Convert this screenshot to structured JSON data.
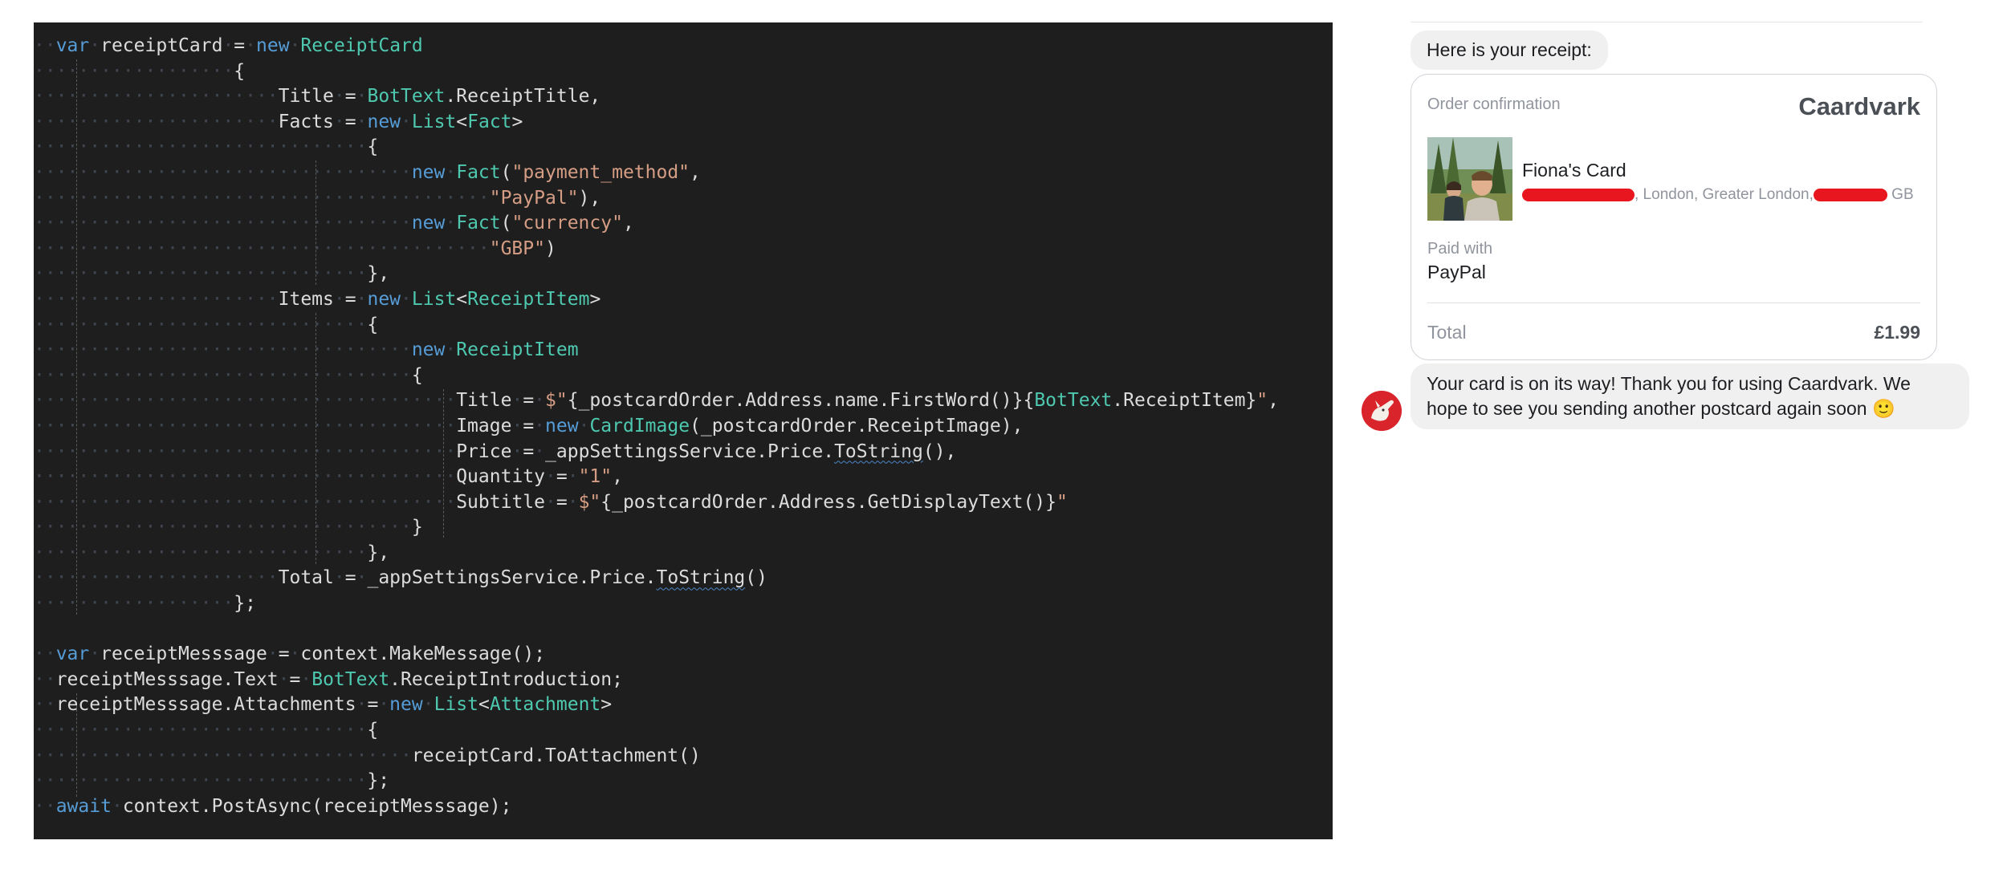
{
  "code": {
    "lines": [
      [
        [
          "ws",
          "··"
        ],
        [
          "kw",
          "var"
        ],
        [
          "ws",
          "·"
        ],
        [
          "pl",
          "receiptCard"
        ],
        [
          "ws",
          "·"
        ],
        [
          "pl",
          "="
        ],
        [
          "ws",
          "·"
        ],
        [
          "kw",
          "new"
        ],
        [
          "ws",
          "·"
        ],
        [
          "ty",
          "ReceiptCard"
        ]
      ],
      [
        [
          "ws",
          "··················"
        ],
        [
          "pl",
          "{"
        ]
      ],
      [
        [
          "ws",
          "······················"
        ],
        [
          "pl",
          "Title"
        ],
        [
          "ws",
          "·"
        ],
        [
          "pl",
          "="
        ],
        [
          "ws",
          "·"
        ],
        [
          "ty",
          "BotText"
        ],
        [
          "pl",
          ".ReceiptTitle,"
        ]
      ],
      [
        [
          "ws",
          "······················"
        ],
        [
          "pl",
          "Facts"
        ],
        [
          "ws",
          "·"
        ],
        [
          "pl",
          "="
        ],
        [
          "ws",
          "·"
        ],
        [
          "kw",
          "new"
        ],
        [
          "ws",
          "·"
        ],
        [
          "ty",
          "List"
        ],
        [
          "pl",
          "<"
        ],
        [
          "ty",
          "Fact"
        ],
        [
          "pl",
          ">"
        ]
      ],
      [
        [
          "ws",
          "······························"
        ],
        [
          "pl",
          "{"
        ]
      ],
      [
        [
          "ws",
          "··································"
        ],
        [
          "kw",
          "new"
        ],
        [
          "ws",
          "·"
        ],
        [
          "ty",
          "Fact"
        ],
        [
          "pl",
          "("
        ],
        [
          "str",
          "\"payment_method\""
        ],
        [
          "pl",
          ","
        ]
      ],
      [
        [
          "ws",
          "·········································"
        ],
        [
          "str",
          "\"PayPal\""
        ],
        [
          "pl",
          "),"
        ]
      ],
      [
        [
          "ws",
          "··································"
        ],
        [
          "kw",
          "new"
        ],
        [
          "ws",
          "·"
        ],
        [
          "ty",
          "Fact"
        ],
        [
          "pl",
          "("
        ],
        [
          "str",
          "\"currency\""
        ],
        [
          "pl",
          ","
        ]
      ],
      [
        [
          "ws",
          "·········································"
        ],
        [
          "str",
          "\"GBP\""
        ],
        [
          "pl",
          ")"
        ]
      ],
      [
        [
          "ws",
          "······························"
        ],
        [
          "pl",
          "},"
        ]
      ],
      [
        [
          "ws",
          "······················"
        ],
        [
          "pl",
          "Items"
        ],
        [
          "ws",
          "·"
        ],
        [
          "pl",
          "="
        ],
        [
          "ws",
          "·"
        ],
        [
          "kw",
          "new"
        ],
        [
          "ws",
          "·"
        ],
        [
          "ty",
          "List"
        ],
        [
          "pl",
          "<"
        ],
        [
          "ty",
          "ReceiptItem"
        ],
        [
          "pl",
          ">"
        ]
      ],
      [
        [
          "ws",
          "······························"
        ],
        [
          "pl",
          "{"
        ]
      ],
      [
        [
          "ws",
          "··································"
        ],
        [
          "kw",
          "new"
        ],
        [
          "ws",
          "·"
        ],
        [
          "ty",
          "ReceiptItem"
        ]
      ],
      [
        [
          "ws",
          "··································"
        ],
        [
          "pl",
          "{"
        ]
      ],
      [
        [
          "ws",
          "······································"
        ],
        [
          "pl",
          "Title"
        ],
        [
          "ws",
          "·"
        ],
        [
          "pl",
          "="
        ],
        [
          "ws",
          "·"
        ],
        [
          "str",
          "$\""
        ],
        [
          "pl",
          "{_postcardOrder.Address.name.FirstWord()}{"
        ],
        [
          "ty",
          "BotText"
        ],
        [
          "pl",
          ".ReceiptItem}"
        ],
        [
          "str",
          "\""
        ],
        [
          "pl",
          ","
        ]
      ],
      [
        [
          "ws",
          "······································"
        ],
        [
          "pl",
          "Image"
        ],
        [
          "ws",
          "·"
        ],
        [
          "pl",
          "="
        ],
        [
          "ws",
          "·"
        ],
        [
          "kw",
          "new"
        ],
        [
          "ws",
          "·"
        ],
        [
          "ty",
          "CardImage"
        ],
        [
          "pl",
          "(_postcardOrder.ReceiptImage),"
        ]
      ],
      [
        [
          "ws",
          "······································"
        ],
        [
          "pl",
          "Price"
        ],
        [
          "ws",
          "·"
        ],
        [
          "pl",
          "="
        ],
        [
          "ws",
          "·"
        ],
        [
          "pl",
          "_appSettingsService.Price."
        ],
        [
          "sq",
          "ToString"
        ],
        [
          "pl",
          "(),"
        ]
      ],
      [
        [
          "ws",
          "······································"
        ],
        [
          "pl",
          "Quantity"
        ],
        [
          "ws",
          "·"
        ],
        [
          "pl",
          "="
        ],
        [
          "ws",
          "·"
        ],
        [
          "str",
          "\"1\""
        ],
        [
          "pl",
          ","
        ]
      ],
      [
        [
          "ws",
          "······································"
        ],
        [
          "pl",
          "Subtitle"
        ],
        [
          "ws",
          "·"
        ],
        [
          "pl",
          "="
        ],
        [
          "ws",
          "·"
        ],
        [
          "str",
          "$\""
        ],
        [
          "pl",
          "{_postcardOrder.Address.GetDisplayText()}"
        ],
        [
          "str",
          "\""
        ]
      ],
      [
        [
          "ws",
          "··································"
        ],
        [
          "pl",
          "}"
        ]
      ],
      [
        [
          "ws",
          "······························"
        ],
        [
          "pl",
          "},"
        ]
      ],
      [
        [
          "ws",
          "······················"
        ],
        [
          "pl",
          "Total"
        ],
        [
          "ws",
          "·"
        ],
        [
          "pl",
          "="
        ],
        [
          "ws",
          "·"
        ],
        [
          "pl",
          "_appSettingsService.Price."
        ],
        [
          "sq",
          "ToString"
        ],
        [
          "pl",
          "()"
        ]
      ],
      [
        [
          "ws",
          "··················"
        ],
        [
          "pl",
          "};"
        ]
      ],
      [],
      [
        [
          "ws",
          "··"
        ],
        [
          "kw",
          "var"
        ],
        [
          "ws",
          "·"
        ],
        [
          "pl",
          "receiptMesssage"
        ],
        [
          "ws",
          "·"
        ],
        [
          "pl",
          "="
        ],
        [
          "ws",
          "·"
        ],
        [
          "pl",
          "context.MakeMessage();"
        ]
      ],
      [
        [
          "ws",
          "··"
        ],
        [
          "pl",
          "receiptMesssage.Text"
        ],
        [
          "ws",
          "·"
        ],
        [
          "pl",
          "="
        ],
        [
          "ws",
          "·"
        ],
        [
          "ty",
          "BotText"
        ],
        [
          "pl",
          ".ReceiptIntroduction;"
        ]
      ],
      [
        [
          "ws",
          "··"
        ],
        [
          "pl",
          "receiptMesssage.Attachments"
        ],
        [
          "ws",
          "·"
        ],
        [
          "pl",
          "="
        ],
        [
          "ws",
          "·"
        ],
        [
          "kw",
          "new"
        ],
        [
          "ws",
          "·"
        ],
        [
          "ty",
          "List"
        ],
        [
          "pl",
          "<"
        ],
        [
          "ty",
          "Attachment"
        ],
        [
          "pl",
          ">"
        ]
      ],
      [
        [
          "ws",
          "······························"
        ],
        [
          "pl",
          "{"
        ]
      ],
      [
        [
          "ws",
          "··································"
        ],
        [
          "pl",
          "receiptCard.ToAttachment()"
        ]
      ],
      [
        [
          "ws",
          "······························"
        ],
        [
          "pl",
          "};"
        ]
      ],
      [
        [
          "ws",
          "··"
        ],
        [
          "kw",
          "await"
        ],
        [
          "ws",
          "·"
        ],
        [
          "pl",
          "context.PostAsync(receiptMesssage);"
        ]
      ]
    ]
  },
  "chat": {
    "intro_message": "Here is your receipt:",
    "receipt": {
      "subtitle": "Order confirmation",
      "brand": "Caardvark",
      "item_title": "Fiona's Card",
      "item_subtitle_middle": ", London, Greater London,",
      "item_subtitle_end": "GB",
      "paid_label": "Paid with",
      "paid_value": "PayPal",
      "total_label": "Total",
      "total_value": "£1.99"
    },
    "final_message": "Your card is on its way! Thank you for using Caardvark. We hope to see you sending another postcard again soon",
    "final_emoji": "🙂"
  },
  "colors": {
    "editor_bg": "#1e1e1e",
    "keyword": "#569cd6",
    "type": "#4ec9b0",
    "string": "#d69d85",
    "redaction": "#e8161e"
  }
}
